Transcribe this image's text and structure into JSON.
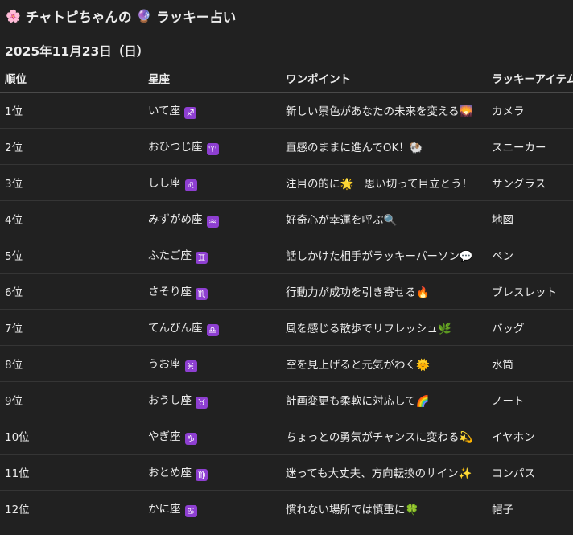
{
  "header": {
    "flower_emoji": "🌸",
    "title_part1": "チャトピちゃんの",
    "crystal_emoji": "🔮",
    "title_part2": "ラッキー占い",
    "date": "2025年11月23日（日）"
  },
  "table": {
    "columns": [
      "順位",
      "星座",
      "ワンポイント",
      "ラッキーアイテム"
    ],
    "rows": [
      {
        "rank": "1位",
        "sign": "いて座",
        "symbol": "♐",
        "tip": "新しい景色があなたの未来を変える🌄",
        "item": "カメラ"
      },
      {
        "rank": "2位",
        "sign": "おひつじ座",
        "symbol": "♈",
        "tip": "直感のままに進んでOK！🐏",
        "item": "スニーカー"
      },
      {
        "rank": "3位",
        "sign": "しし座",
        "symbol": "♌",
        "tip": "注目の的に🌟　思い切って目立とう！",
        "item": "サングラス"
      },
      {
        "rank": "4位",
        "sign": "みずがめ座",
        "symbol": "♒",
        "tip": "好奇心が幸運を呼ぶ🔍",
        "item": "地図"
      },
      {
        "rank": "5位",
        "sign": "ふたご座",
        "symbol": "♊",
        "tip": "話しかけた相手がラッキーパーソン💬",
        "item": "ペン"
      },
      {
        "rank": "6位",
        "sign": "さそり座",
        "symbol": "♏",
        "tip": "行動力が成功を引き寄せる🔥",
        "item": "ブレスレット"
      },
      {
        "rank": "7位",
        "sign": "てんびん座",
        "symbol": "♎",
        "tip": "風を感じる散歩でリフレッシュ🌿",
        "item": "バッグ"
      },
      {
        "rank": "8位",
        "sign": "うお座",
        "symbol": "♓",
        "tip": "空を見上げると元気がわく🌞",
        "item": "水筒"
      },
      {
        "rank": "9位",
        "sign": "おうし座",
        "symbol": "♉",
        "tip": "計画変更も柔軟に対応して🌈",
        "item": "ノート"
      },
      {
        "rank": "10位",
        "sign": "やぎ座",
        "symbol": "♑",
        "tip": "ちょっとの勇気がチャンスに変わる💫",
        "item": "イヤホン"
      },
      {
        "rank": "11位",
        "sign": "おとめ座",
        "symbol": "♍",
        "tip": "迷っても大丈夫、方向転換のサイン✨",
        "item": "コンパス"
      },
      {
        "rank": "12位",
        "sign": "かに座",
        "symbol": "♋",
        "tip": "慣れない場所では慎重に🍀",
        "item": "帽子"
      }
    ]
  }
}
